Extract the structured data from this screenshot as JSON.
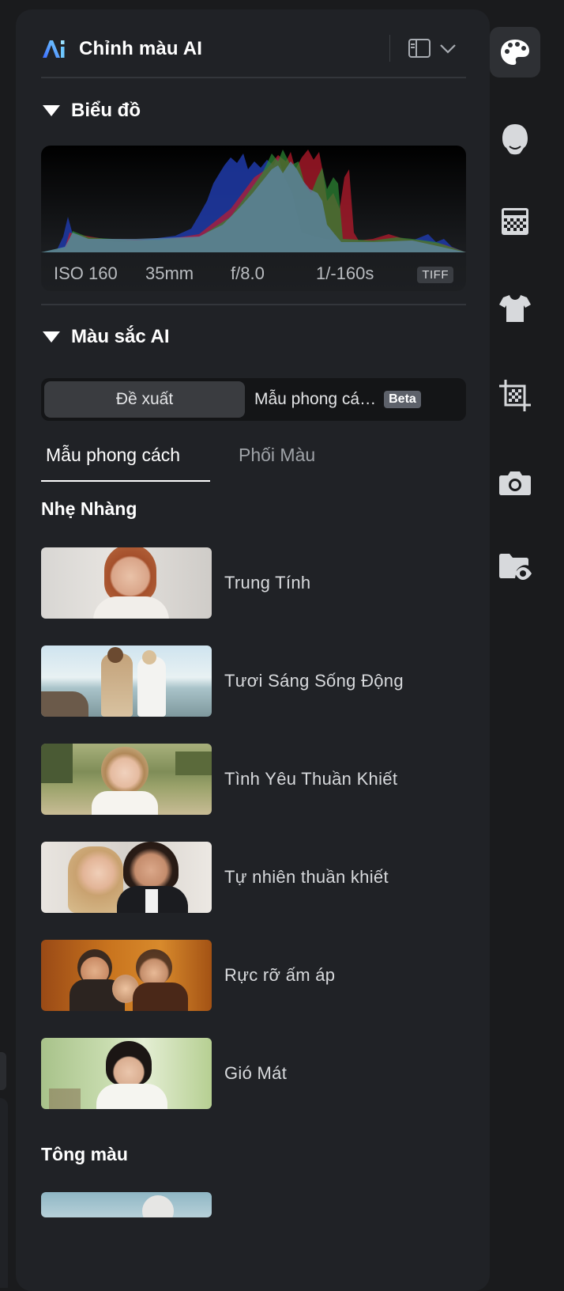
{
  "panel": {
    "title": "Chỉnh màu AI"
  },
  "histogram": {
    "section_title": "Biểu đồ",
    "iso": "ISO 160",
    "focal": "35mm",
    "aperture": "f/8.0",
    "shutter": "1/-160s",
    "format": "TIFF"
  },
  "ai_color": {
    "section_title": "Màu sắc AI",
    "segment_suggest": "Đề xuất",
    "segment_styles": "Mẫu phong cá…",
    "beta_badge": "Beta",
    "tabs": [
      {
        "label": "Mẫu phong cách",
        "active": true
      },
      {
        "label": "Phối Màu",
        "active": false
      }
    ],
    "group_soft": "Nhẹ Nhàng",
    "styles": [
      {
        "label": "Trung Tính"
      },
      {
        "label": "Tươi Sáng Sống Động"
      },
      {
        "label": "Tình Yêu Thuần Khiết"
      },
      {
        "label": "Tự nhiên thuần khiết"
      },
      {
        "label": "Rực rỡ ấm áp"
      },
      {
        "label": "Gió Mát"
      }
    ],
    "group_tone": "Tông màu"
  },
  "toolbar": {
    "icons": [
      "palette-icon",
      "face-icon",
      "pattern-icon",
      "shirt-icon",
      "crop-icon",
      "camera-icon",
      "folder-eye-icon"
    ],
    "active": "palette-icon"
  },
  "colors": {
    "panel_bg": "#202226",
    "app_bg": "#1a1b1d",
    "accent_white": "#ffffff"
  }
}
